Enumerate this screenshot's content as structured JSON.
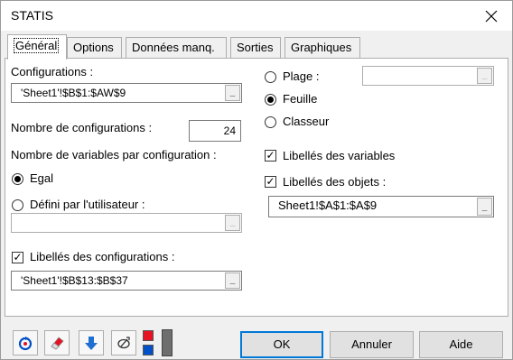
{
  "window": {
    "title": "STATIS"
  },
  "tabs": [
    {
      "label": "Général"
    },
    {
      "label": "Options"
    },
    {
      "label": "Données manq."
    },
    {
      "label": "Sorties"
    },
    {
      "label": "Graphiques"
    }
  ],
  "general": {
    "configurations_label": "Configurations :",
    "configurations_value": "'Sheet1'!$B$1:$AW$9",
    "nb_configurations_label": "Nombre de configurations :",
    "nb_configurations_value": "24",
    "nb_variables_label": "Nombre de variables par configuration :",
    "egal_label": "Egal",
    "defini_label": "Défini par l'utilisateur :",
    "defini_value": "",
    "libelles_configurations_label": "Libellés des configurations :",
    "libelles_configurations_checked": true,
    "libelles_configurations_value": "'Sheet1'!$B$13:$B$37",
    "plage_label": "Plage :",
    "plage_value": "",
    "feuille_label": "Feuille",
    "classeur_label": "Classeur",
    "selected_destination": "Feuille",
    "libelles_variables_label": "Libellés des variables",
    "libelles_variables_checked": true,
    "libelles_objets_label": "Libellés des objets :",
    "libelles_objets_checked": true,
    "libelles_objets_value": "Sheet1!$A$1:$A$9"
  },
  "footer": {
    "ok_label": "OK",
    "cancel_label": "Annuler",
    "help_label": "Aide"
  },
  "colors": {
    "accent": "#0078d7",
    "red": "#e81123",
    "blue": "#0050c8"
  },
  "icons": [
    "reset-icon",
    "eraser-icon",
    "down-arrow-icon",
    "selection-icon",
    "color-swatch-icon"
  ]
}
